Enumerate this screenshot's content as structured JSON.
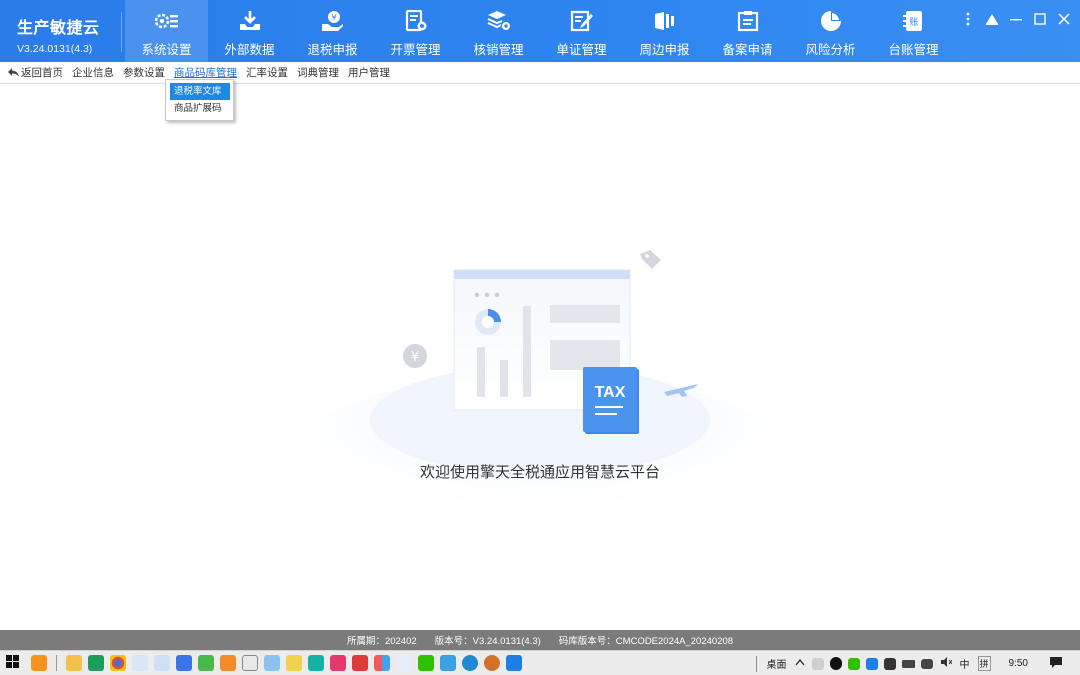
{
  "app": {
    "title": "生产敏捷云",
    "version": "V3.24.0131(4.3)"
  },
  "nav": [
    {
      "label": "系统设置",
      "icon": "settings-icon"
    },
    {
      "label": "外部数据",
      "icon": "download-icon"
    },
    {
      "label": "退税申报",
      "icon": "tax-refund-icon"
    },
    {
      "label": "开票管理",
      "icon": "invoice-icon"
    },
    {
      "label": "核销管理",
      "icon": "verify-icon"
    },
    {
      "label": "单证管理",
      "icon": "document-edit-icon"
    },
    {
      "label": "周边申报",
      "icon": "filing-icon"
    },
    {
      "label": "备案申请",
      "icon": "record-icon"
    },
    {
      "label": "风险分析",
      "icon": "pie-chart-icon"
    },
    {
      "label": "台账管理",
      "icon": "ledger-icon"
    }
  ],
  "subnav": [
    "返回首页",
    "企业信息",
    "参数设置",
    "商品码库管理",
    "汇率设置",
    "词典管理",
    "用户管理"
  ],
  "dropdown": [
    "退税率文库",
    "商品扩展码"
  ],
  "illustration": {
    "tag_text": "TAX"
  },
  "welcome": "欢迎使用擎天全税通应用智慧云平台",
  "status": {
    "period": "所属期：202402",
    "version": "版本号：V3.24.0131(4.3)",
    "code_version": "码库版本号：CMCODE2024A_20240208"
  },
  "taskbar": {
    "desktop": "桌面",
    "ime_lang": "中",
    "ime_mode": "拼",
    "time": "9:50"
  },
  "colors": {
    "header": "#2f86f0",
    "active_sub": "#1f6fd8",
    "status_bar": "#7b7b7b"
  }
}
